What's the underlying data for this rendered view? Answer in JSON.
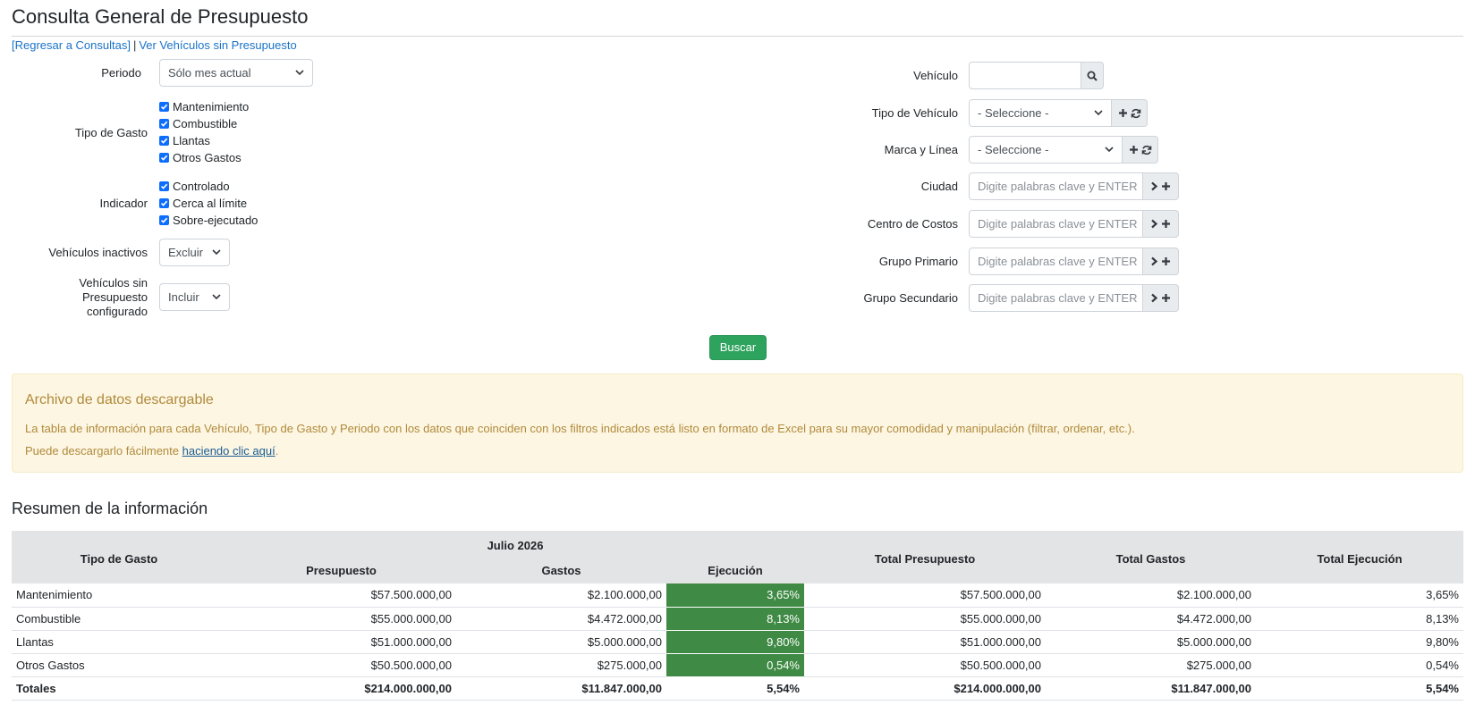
{
  "page": {
    "title": "Consulta General de Presupuesto",
    "link_back": "[Regresar a Consultas]",
    "link_separator": "|",
    "link_no_budget": "Ver Vehículos sin Presupuesto"
  },
  "filters_left": {
    "periodo": {
      "label": "Periodo",
      "value": "Sólo mes actual"
    },
    "tipo_gasto": {
      "label": "Tipo de Gasto",
      "options": [
        "Mantenimiento",
        "Combustible",
        "Llantas",
        "Otros Gastos"
      ]
    },
    "indicador": {
      "label": "Indicador",
      "options": [
        "Controlado",
        "Cerca al límite",
        "Sobre-ejecutado"
      ]
    },
    "inactivos": {
      "label": "Vehículos inactivos",
      "value": "Excluir"
    },
    "sin_presupuesto": {
      "label_l1": "Vehículos sin",
      "label_l2": "Presupuesto",
      "label_l3": "configurado",
      "value": "Incluir"
    }
  },
  "filters_right": {
    "vehiculo": {
      "label": "Vehículo",
      "value": ""
    },
    "tipo_vehiculo": {
      "label": "Tipo de Vehículo",
      "value": "- Seleccione -"
    },
    "marca_linea": {
      "label": "Marca y Línea",
      "value": "- Seleccione -"
    },
    "ciudad": {
      "label": "Ciudad",
      "placeholder": "Digite palabras clave y ENTER"
    },
    "centro_costos": {
      "label": "Centro de Costos",
      "placeholder": "Digite palabras clave y ENTER"
    },
    "grupo_primario": {
      "label": "Grupo Primario",
      "placeholder": "Digite palabras clave y ENTER"
    },
    "grupo_secundario": {
      "label": "Grupo Secundario",
      "placeholder": "Digite palabras clave y ENTER"
    }
  },
  "search_button": "Buscar",
  "alert": {
    "title": "Archivo de datos descargable",
    "text1": "La tabla de información para cada Vehículo, Tipo de Gasto y Periodo con los datos que coinciden con los filtros indicados está listo en formato de Excel para su mayor comodidad y manipulación (filtrar, ordenar, etc.).",
    "text2_prefix": "Puede descargarlo fácilmente ",
    "text2_link": "haciendo clic aquí",
    "text2_suffix": "."
  },
  "summary": {
    "title": "Resumen de la información",
    "headers": {
      "tipo": "Tipo de Gasto",
      "month": "Julio 2026",
      "presupuesto": "Presupuesto",
      "gastos": "Gastos",
      "ejecucion": "Ejecución",
      "total_presupuesto": "Total Presupuesto",
      "total_gastos": "Total Gastos",
      "total_ejecucion": "Total Ejecución"
    },
    "rows": [
      [
        "Mantenimiento",
        "$57.500.000,00",
        "$2.100.000,00",
        "3,65%",
        "$57.500.000,00",
        "$2.100.000,00",
        "3,65%"
      ],
      [
        "Combustible",
        "$55.000.000,00",
        "$4.472.000,00",
        "8,13%",
        "$55.000.000,00",
        "$4.472.000,00",
        "8,13%"
      ],
      [
        "Llantas",
        "$51.000.000,00",
        "$5.000.000,00",
        "9,80%",
        "$51.000.000,00",
        "$5.000.000,00",
        "9,80%"
      ],
      [
        "Otros Gastos",
        "$50.500.000,00",
        "$275.000,00",
        "0,54%",
        "$50.500.000,00",
        "$275.000,00",
        "0,54%"
      ]
    ],
    "totals": [
      "Totales",
      "$214.000.000,00",
      "$11.847.000,00",
      "5,54%",
      "$214.000.000,00",
      "$11.847.000,00",
      "5,54%"
    ]
  },
  "colors": {
    "execution_cell": "#3f8a44",
    "button": "#2ea35e",
    "link": "#1a73c8",
    "alert_bg": "#fdf6e2"
  }
}
